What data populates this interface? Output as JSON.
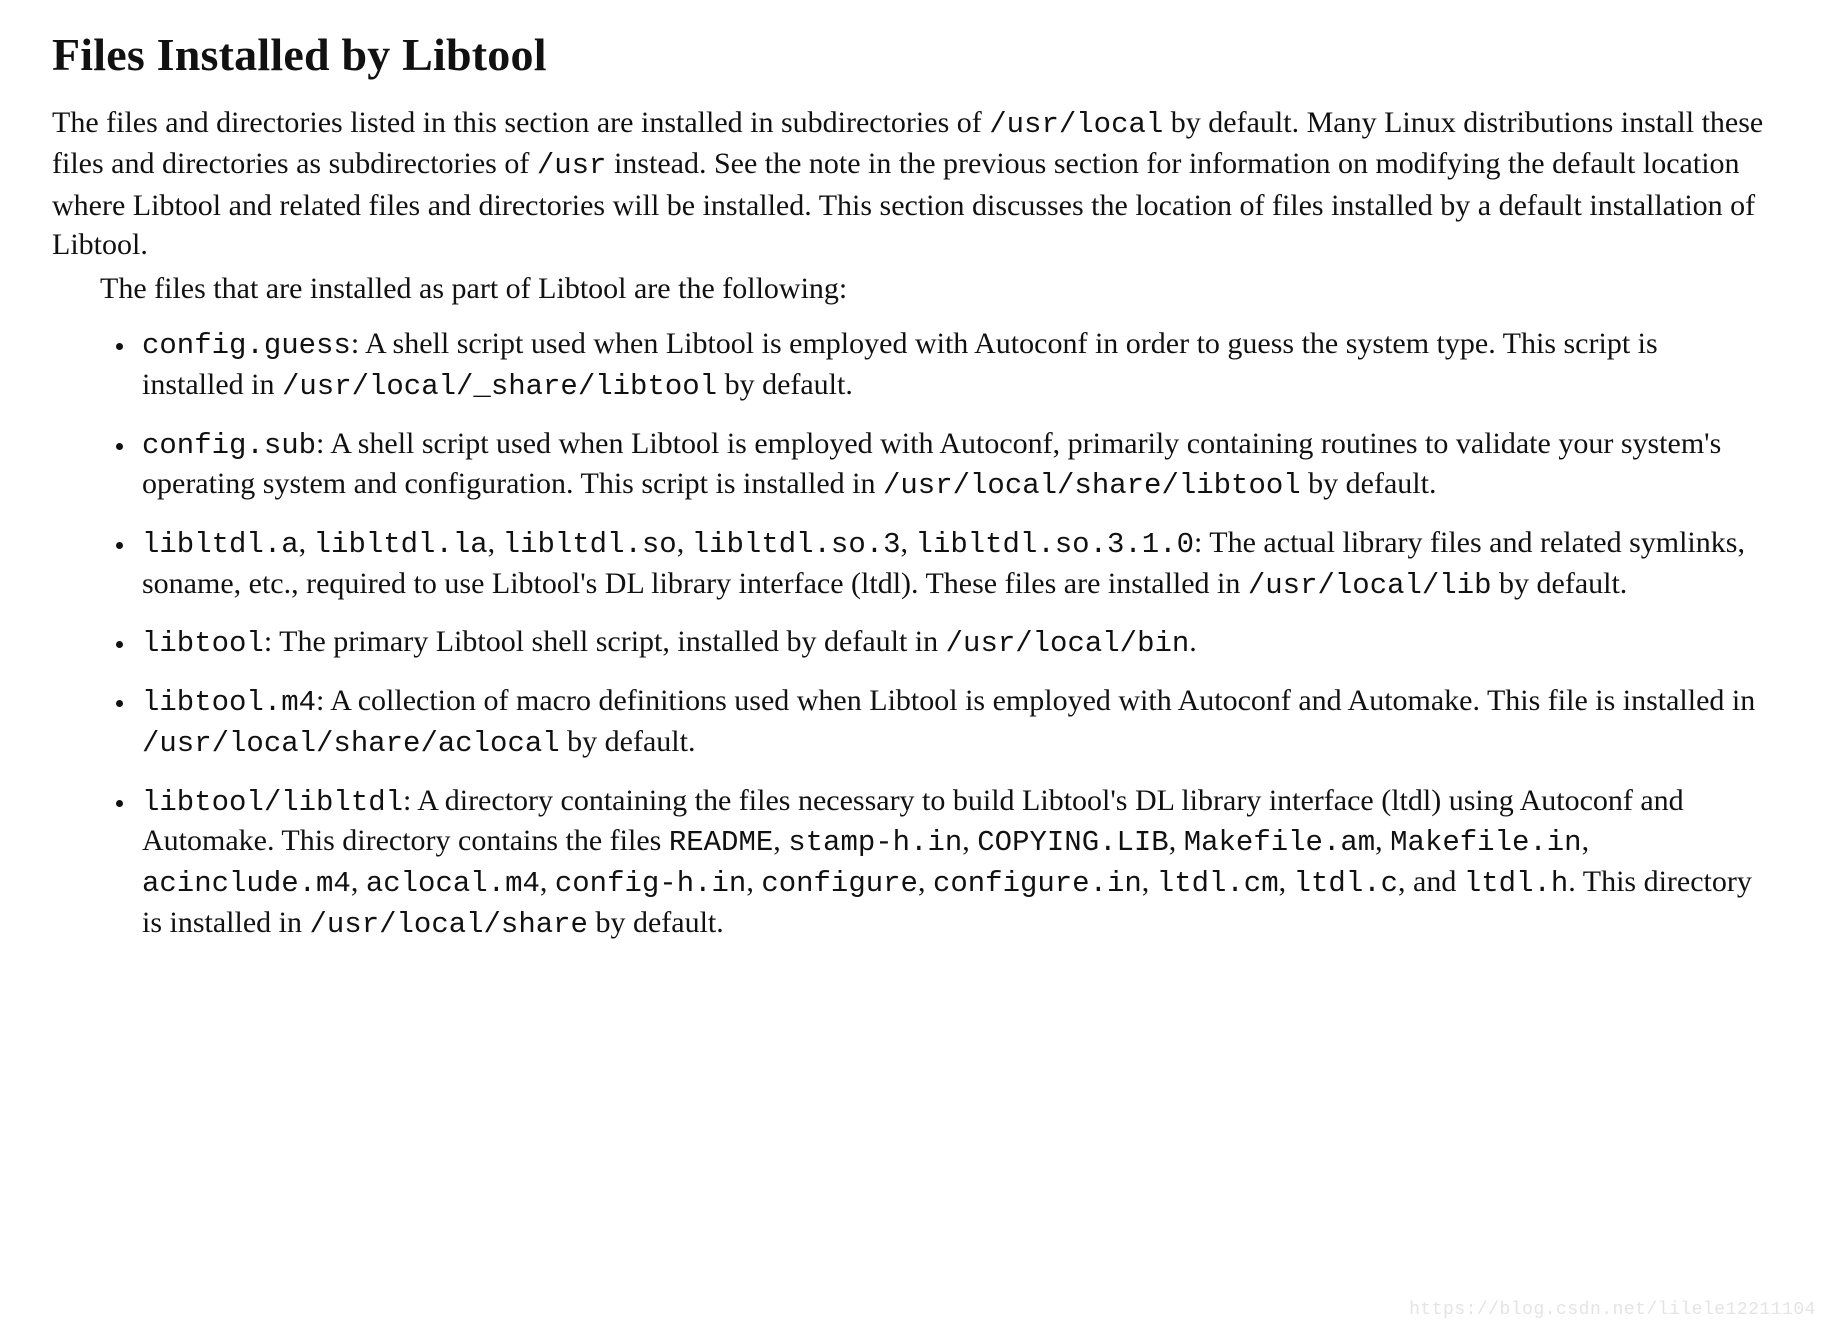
{
  "title": "Files Installed by Libtool",
  "intro": {
    "p1_a": "The files and directories listed in this section are installed in subdirectories of ",
    "p1_code1": "/usr/local",
    "p1_b": " by default. Many Linux distributions install these files and directories as subdirectories of ",
    "p1_code2": "/usr",
    "p1_c": " instead. See the note in the previous section for information on modifying the default location where Libtool and related files and directories will be installed. This section discusses the location of files installed by a default installation of Libtool.",
    "p2": "The files that are installed as part of Libtool are the following:"
  },
  "items": {
    "i0": {
      "name": "config.guess",
      "a": ": A shell script used when Libtool is employed with Autoconf in order to guess the system type. This script is installed in ",
      "path": "/usr/local/_share/libtool",
      "b": " by default."
    },
    "i1": {
      "name": "config.sub",
      "a": ": A shell script used when Libtool is employed with Autoconf, primarily containing routines to validate your system's operating system and configuration. This script is installed in ",
      "path": "/usr/local/share/libtool",
      "b": " by default."
    },
    "i2": {
      "n0": "libltdl.a",
      "s0": ", ",
      "n1": "libltdl.la",
      "s1": ", ",
      "n2": "libltdl.so",
      "s2": ", ",
      "n3": "libltdl.so.3",
      "s3": ", ",
      "n4": "libltdl.so.3.1.0",
      "a": ": The actual library files and related symlinks, soname, etc., required to use Libtool's DL library interface (ltdl). These files are installed in ",
      "path": "/usr/local/lib",
      "b": " by default."
    },
    "i3": {
      "name": "libtool",
      "a": ": The primary Libtool shell script, installed by default in ",
      "path": "/usr/local/bin",
      "b": "."
    },
    "i4": {
      "name": "libtool.m4",
      "a": ": A collection of macro definitions used when Libtool is employed with Autoconf and Automake. This file is installed in ",
      "path": "/usr/local/share/aclocal",
      "b": " by default."
    },
    "i5": {
      "name": "libtool/libltdl",
      "a": ": A directory containing the files necessary to build Libtool's DL library interface (ltdl) using Autoconf and Automake. This directory contains the files ",
      "f0": "README",
      "c0": ", ",
      "f1": "stamp-h.in",
      "c1": ", ",
      "f2": "COPYING.LIB",
      "c2": ", ",
      "f3": "Makefile.am",
      "c3": ", ",
      "f4": "Makefile.in",
      "c4": ", ",
      "f5": "acinclude.m4",
      "c5": ", ",
      "f6": "aclocal.m4",
      "c6": ", ",
      "f7": "config-h.in",
      "c7": ", ",
      "f8": "configure",
      "c8": ", ",
      "f9": "configure.in",
      "c9": ", ",
      "f10": "ltdl.cm",
      "c10": ", ",
      "f11": "ltdl.c",
      "c11": ", and ",
      "f12": "ltdl.h",
      "b": ". This directory is installed in ",
      "path": "/usr/local/share",
      "d": " by default."
    }
  },
  "watermark": "https://blog.csdn.net/lilele12211104"
}
